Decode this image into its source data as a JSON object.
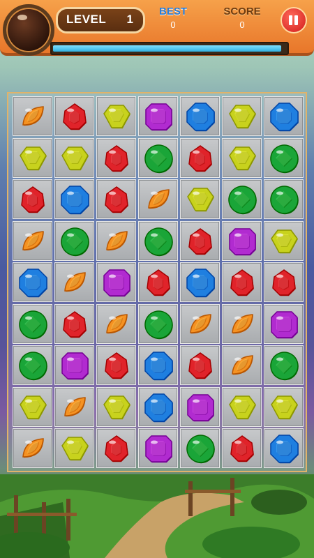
{
  "hud": {
    "level_label": "LEVEL",
    "level_value": "1",
    "best_label": "BEST",
    "best_value": "0",
    "score_label": "SCORE",
    "score_value": "0",
    "progress_fraction": 0.985
  },
  "colors": {
    "orange": "#f59222",
    "red": "#e0232a",
    "yellow": "#c8d21d",
    "purple": "#b12bd0",
    "blue": "#1f7fe0",
    "green": "#1aa538"
  },
  "board": {
    "rows": [
      [
        "orange",
        "red",
        "yellow",
        "purple",
        "blue",
        "yellow",
        "blue"
      ],
      [
        "yellow",
        "yellow",
        "red",
        "green",
        "red",
        "yellow",
        "green"
      ],
      [
        "red",
        "blue",
        "red",
        "orange",
        "yellow",
        "green",
        "green"
      ],
      [
        "orange",
        "green",
        "orange",
        "green",
        "red",
        "purple",
        "yellow"
      ],
      [
        "blue",
        "orange",
        "purple",
        "red",
        "blue",
        "red",
        "red"
      ],
      [
        "green",
        "red",
        "orange",
        "green",
        "orange",
        "orange",
        "purple"
      ],
      [
        "green",
        "purple",
        "red",
        "blue",
        "red",
        "orange",
        "green"
      ],
      [
        "yellow",
        "orange",
        "yellow",
        "blue",
        "purple",
        "yellow",
        "yellow"
      ],
      [
        "orange",
        "yellow",
        "red",
        "purple",
        "green",
        "red",
        "blue"
      ]
    ]
  }
}
